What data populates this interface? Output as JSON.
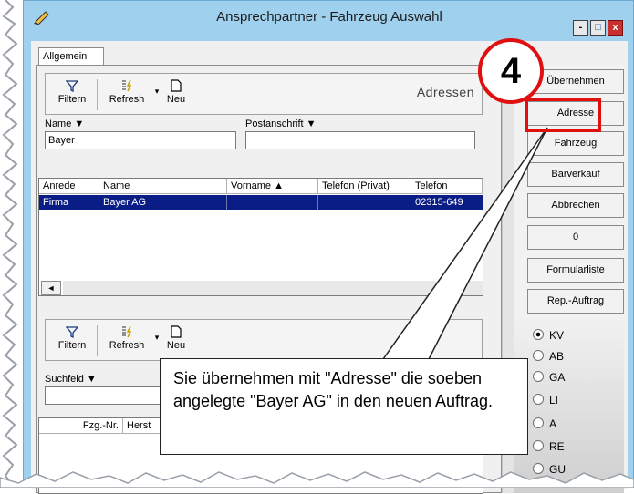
{
  "window": {
    "title": "Ansprechpartner - Fahrzeug Auswahl",
    "controls": [
      "-",
      "□",
      "x"
    ]
  },
  "tabs": [
    {
      "label": "Allgemein"
    }
  ],
  "address_section": {
    "title": "Adressen",
    "toolbar": {
      "filter": "Filtern",
      "refresh": "Refresh",
      "new": "Neu"
    },
    "filters": {
      "name_label": "Name ▼",
      "name_value": "Bayer",
      "postal_label": "Postanschrift ▼",
      "postal_value": ""
    },
    "columns": [
      "Anrede",
      "Name",
      "Vorname ▲",
      "Telefon (Privat)",
      "Telefon"
    ],
    "rows": [
      {
        "anrede": "Firma",
        "name": "Bayer AG",
        "vorname": "",
        "telefon_privat": "",
        "telefon": "02315-649"
      }
    ],
    "scroll_left": "◄"
  },
  "vehicle_section": {
    "toolbar": {
      "filter": "Filtern",
      "refresh": "Refresh",
      "new": "Neu"
    },
    "search_label": "Suchfeld ▼",
    "columns": [
      "Fzg.-Nr.",
      "Herst"
    ]
  },
  "side_buttons": {
    "uebernehmen": "Übernehmen",
    "adresse": "Adresse",
    "fahrzeug": "Fahrzeug",
    "barverkauf": "Barverkauf",
    "abbrechen": "Abbrechen",
    "zero": "0",
    "formularliste": "Formularliste",
    "rep_auftrag": "Rep.-Auftrag"
  },
  "radio_options": [
    {
      "label": "KV",
      "selected": true
    },
    {
      "label": "AB",
      "selected": false
    },
    {
      "label": "GA",
      "selected": false
    },
    {
      "label": "LI",
      "selected": false
    },
    {
      "label": "A",
      "selected": false
    },
    {
      "label": "RE",
      "selected": false
    },
    {
      "label": "GU",
      "selected": false
    }
  ],
  "annotation": {
    "step": "4",
    "text": "Sie übernehmen mit \"Adresse\" die soeben angelegte \"Bayer AG\" in den neuen Auftrag."
  },
  "colors": {
    "title_bg": "#9fd0ee",
    "selection": "#0a1c86",
    "highlight": "#e01010"
  }
}
